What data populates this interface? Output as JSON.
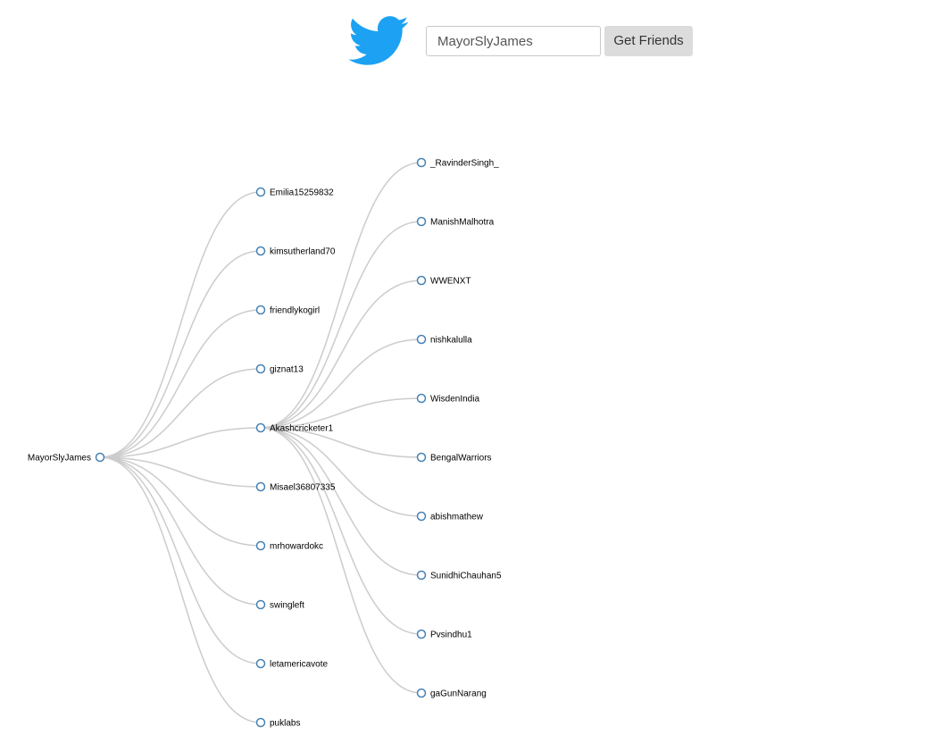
{
  "header": {
    "logo_icon": "twitter-bird-icon",
    "logo_color": "#1da1f2",
    "search_value": "MayorSlyJames",
    "button_label": "Get Friends"
  },
  "tree": {
    "name": "MayorSlyJames",
    "children": [
      {
        "name": "Emilia15259832"
      },
      {
        "name": "kimsutherland70"
      },
      {
        "name": "friendlykogirl"
      },
      {
        "name": "giznat13"
      },
      {
        "name": "Akashcricketer1",
        "children": [
          {
            "name": "_RavinderSingh_"
          },
          {
            "name": "ManishMalhotra"
          },
          {
            "name": "WWENXT"
          },
          {
            "name": "nishkalulla"
          },
          {
            "name": "WisdenIndia"
          },
          {
            "name": "BengalWarriors"
          },
          {
            "name": "abishmathew"
          },
          {
            "name": "SunidhiChauhan5"
          },
          {
            "name": "Pvsindhu1"
          },
          {
            "name": "gaGunNarang"
          }
        ]
      },
      {
        "name": "Misael36807335"
      },
      {
        "name": "mrhowardokc"
      },
      {
        "name": "swingleft"
      },
      {
        "name": "letamericavote"
      },
      {
        "name": "puklabs"
      }
    ]
  },
  "colors": {
    "link": "#cccccc",
    "node_stroke": "#4682b4"
  }
}
